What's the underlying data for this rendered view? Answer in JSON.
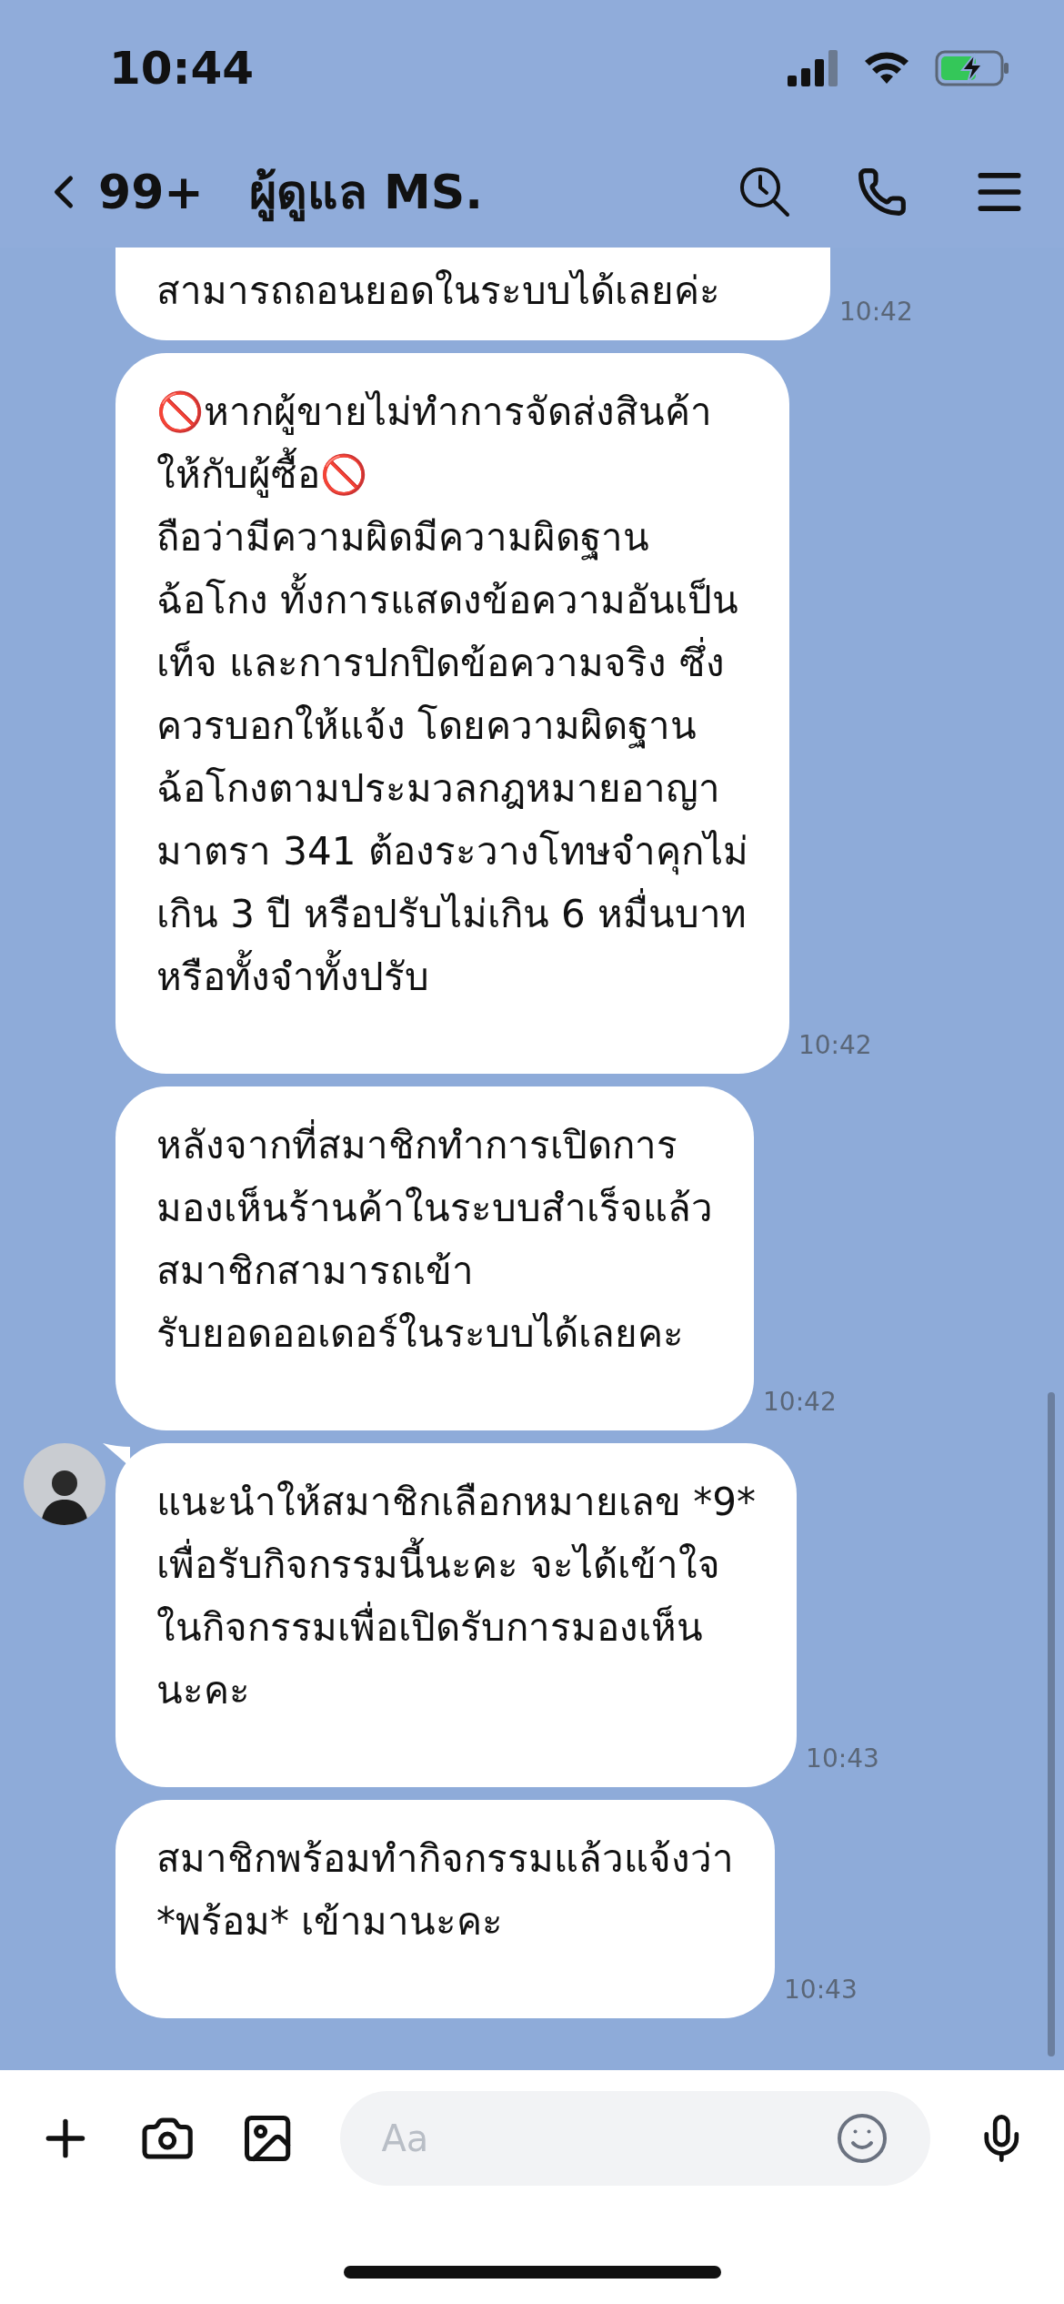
{
  "status_bar": {
    "time": "10:44"
  },
  "header": {
    "back_count": "99+",
    "title": "ผู้ดูแล MS."
  },
  "messages": [
    {
      "kind": "cut",
      "text": "สามารถถอนยอดในระบบได้เลยค่ะ",
      "time": "10:42"
    },
    {
      "kind": "full",
      "show_avatar": false,
      "text": "🚫หากผู้ขายไม่ทำการจัดส่งสินค้า\nให้กับผู้ซื้อ🚫\nถือว่ามีความผิดมีความผิดฐาน\nฉ้อโกง ทั้งการแสดงข้อความอันเป็น\nเท็จ และการปกปิดข้อความจริง ซึ่ง\nควรบอกให้แจ้ง โดยความผิดฐาน\nฉ้อโกงตามประมวลกฎหมายอาญา\nมาตรา 341 ต้องระวางโทษจำคุกไม่\nเกิน 3 ปี หรือปรับไม่เกิน 6 หมื่นบาท\nหรือทั้งจำทั้งปรับ",
      "time": "10:42"
    },
    {
      "kind": "full",
      "show_avatar": false,
      "text": "หลังจากที่สมาชิกทำการเปิดการ\nมองเห็นร้านค้าในระบบสำเร็จแล้ว\nสมาชิกสามารถเข้า\nรับยอดออเดอร์ในระบบได้เลยคะ",
      "time": "10:42"
    },
    {
      "kind": "full",
      "show_avatar": true,
      "text": "แนะนำให้สมาชิกเลือกหมายเลข *9*\nเพื่อรับกิจกรรมนี้นะคะ จะได้เข้าใจ\nในกิจกรรมเพื่อเปิดรับการมองเห็น\nนะคะ",
      "time": "10:43"
    },
    {
      "kind": "full",
      "show_avatar": false,
      "text": "สมาชิกพร้อมทำกิจกรรมแล้วแจ้งว่า\n*พร้อม* เข้ามานะคะ",
      "time": "10:43"
    }
  ],
  "composer": {
    "placeholder": "Aa"
  }
}
